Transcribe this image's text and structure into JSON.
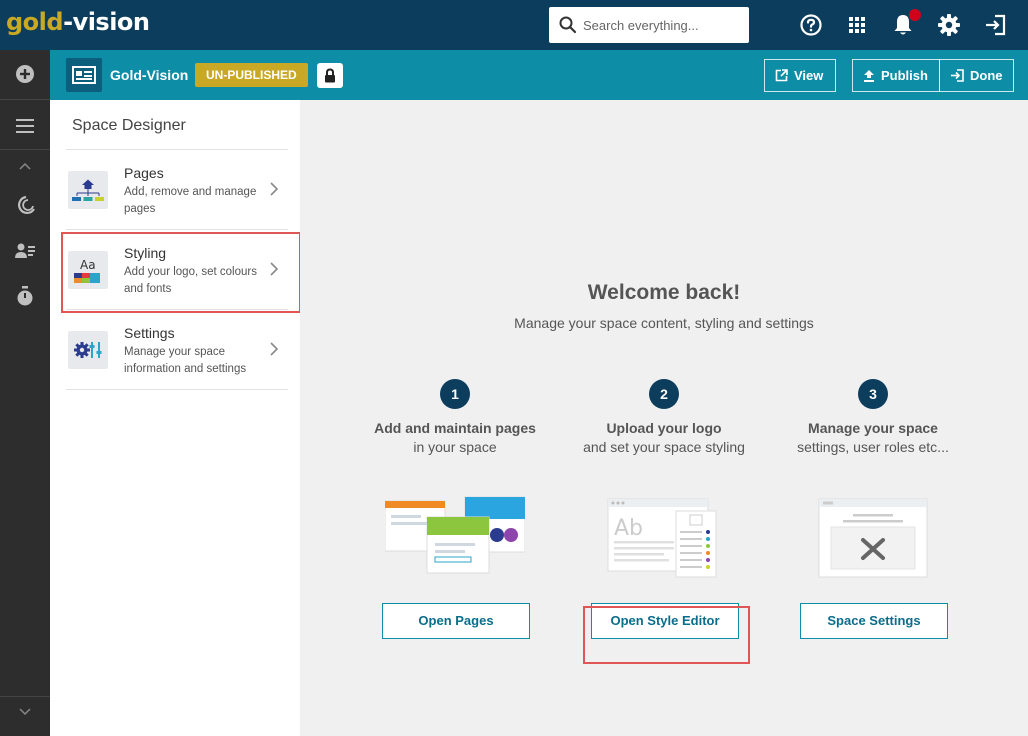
{
  "topbar": {
    "logo_part1": "gold",
    "logo_dot": "-",
    "logo_part2": "vision",
    "search_placeholder": "Search everything...",
    "icons": [
      "help-icon",
      "apps-grid-icon",
      "bell-icon",
      "gear-icon",
      "exit-icon"
    ]
  },
  "rail": {
    "icons": [
      "plus-circle-icon",
      "menu-icon",
      "chevron-up-icon",
      "moon-icon",
      "contacts-icon",
      "stopwatch-icon",
      "chevron-down-icon"
    ]
  },
  "subheader": {
    "title": "Gold-Vision",
    "status": "UN-PUBLISHED",
    "view_label": "View",
    "publish_label": "Publish",
    "done_label": "Done"
  },
  "panel": {
    "title": "Space Designer",
    "items": [
      {
        "title": "Pages",
        "desc": "Add, remove and manage pages"
      },
      {
        "title": "Styling",
        "desc": "Add your logo, set colours and fonts"
      },
      {
        "title": "Settings",
        "desc": "Manage your space information and settings"
      }
    ]
  },
  "main": {
    "welcome_title": "Welcome back!",
    "welcome_sub": "Manage your space content, styling and settings",
    "steps": [
      {
        "num": "1",
        "bold": "Add and maintain pages",
        "rest": "in your space",
        "button": "Open Pages"
      },
      {
        "num": "2",
        "bold": "Upload your logo",
        "rest": "and set your space styling",
        "button": "Open Style Editor"
      },
      {
        "num": "3",
        "bold": "Manage your space",
        "rest": "settings, user roles etc...",
        "button": "Space Settings"
      }
    ]
  },
  "colors": {
    "topbar": "#0d3d5c",
    "subheader": "#0e8da7",
    "gold": "#c9a825",
    "rail": "#2d2d2d",
    "highlight": "#e05555"
  }
}
